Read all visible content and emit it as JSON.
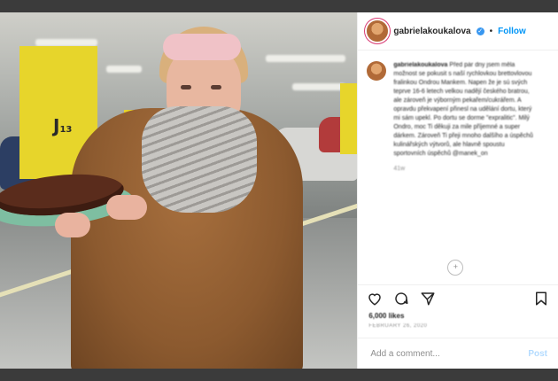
{
  "photo": {
    "pillar_label": "J",
    "pillar_label_sub": "13"
  },
  "header": {
    "username": "gabrielakoukalova",
    "verified_mark": "✓",
    "separator": "•",
    "follow_label": "Follow"
  },
  "caption": {
    "username": "gabrielakoukalova",
    "text": "Před pár dny jsem měla možnost se pokusit s naší rychlovkou brettovlovou fralinkou Ondrou Mankem. Napen že je sú svých teprve 16-6 letech velkou nadějí českého bratrou, ale zároveň je výborným pekařem/cukrářem. A opravdu překvapení přinesl na udělání dortu, který mi sám upekl. Po dortu se dorme \"expralitic\". Milý Ondro, moc Ti děkuji za mile příjemné a super dárkem. Zároveň Ti přeji mnoho dalšího a úspěchů kulinářských výtvorů, ale hlavně spoustu sportovních úspěchů @manek_on",
    "mention": "@manek_on",
    "time": "41w"
  },
  "load_more_icon": "plus-circle-icon",
  "actions": {
    "like_icon": "heart-icon",
    "comment_icon": "comment-icon",
    "share_icon": "share-icon",
    "save_icon": "bookmark-icon"
  },
  "likes": "6,000 likes",
  "date": "FEBRUARY 26, 2020",
  "add_comment": {
    "placeholder": "Add a comment...",
    "post_label": "Post"
  },
  "colors": {
    "accent": "#0095f6",
    "verified": "#3897f0",
    "post_disabled": "#b3dbff",
    "pillar": "#e7d52b"
  }
}
